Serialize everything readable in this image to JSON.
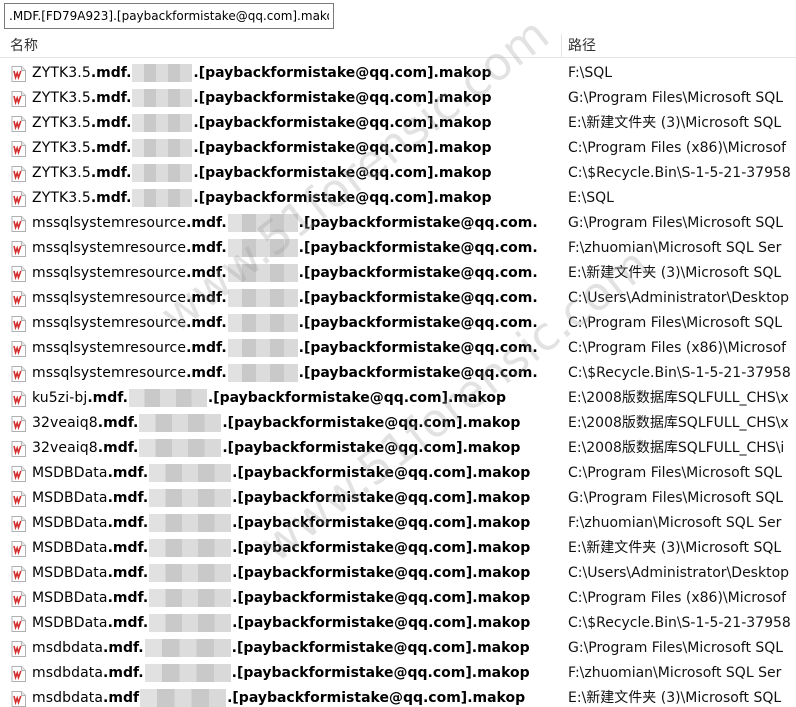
{
  "search": {
    "value": ".MDF.[FD79A923].[paybackformistake@qq.com].makop"
  },
  "columns": {
    "name": "名称",
    "path": "路径"
  },
  "watermark": "www.51forensic.com",
  "rows": [
    {
      "prefix": "ZYTK3.5",
      "ext": ".mdf.",
      "blur": 60,
      "suffix": ".[paybackformistake@qq.com].makop",
      "path": "F:\\SQL"
    },
    {
      "prefix": "ZYTK3.5",
      "ext": ".mdf.",
      "blur": 60,
      "suffix": ".[paybackformistake@qq.com].makop",
      "path": "G:\\Program Files\\Microsoft SQL"
    },
    {
      "prefix": "ZYTK3.5",
      "ext": ".mdf.",
      "blur": 60,
      "suffix": ".[paybackformistake@qq.com].makop",
      "path": "E:\\新建文件夹 (3)\\Microsoft SQL"
    },
    {
      "prefix": "ZYTK3.5",
      "ext": ".mdf.",
      "blur": 60,
      "suffix": ".[paybackformistake@qq.com].makop",
      "path": "C:\\Program Files (x86)\\Microsof"
    },
    {
      "prefix": "ZYTK3.5",
      "ext": ".mdf.",
      "blur": 60,
      "suffix": ".[paybackformistake@qq.com].makop",
      "path": "C:\\$Recycle.Bin\\S-1-5-21-37958"
    },
    {
      "prefix": "ZYTK3.5",
      "ext": ".mdf.",
      "blur": 60,
      "suffix": ".[paybackformistake@qq.com].makop",
      "path": "E:\\SQL"
    },
    {
      "prefix": "mssqlsystemresource",
      "ext": ".mdf.",
      "blur": 70,
      "suffix": ".[paybackformistake@qq.com.",
      "path": "G:\\Program Files\\Microsoft SQL"
    },
    {
      "prefix": "mssqlsystemresource",
      "ext": ".mdf.",
      "blur": 70,
      "suffix": ".[paybackformistake@qq.com.",
      "path": "F:\\zhuomian\\Microsoft SQL Ser"
    },
    {
      "prefix": "mssqlsystemresource",
      "ext": ".mdf.",
      "blur": 70,
      "suffix": ".[paybackformistake@qq.com.",
      "path": "E:\\新建文件夹 (3)\\Microsoft SQL"
    },
    {
      "prefix": "mssqlsystemresource",
      "ext": ".mdf.",
      "blur": 70,
      "suffix": ".[paybackformistake@qq.com.",
      "path": "C:\\Users\\Administrator\\Desktop"
    },
    {
      "prefix": "mssqlsystemresource",
      "ext": ".mdf.",
      "blur": 70,
      "suffix": ".[paybackformistake@qq.com.",
      "path": "C:\\Program Files\\Microsoft SQL"
    },
    {
      "prefix": "mssqlsystemresource",
      "ext": ".mdf.",
      "blur": 70,
      "suffix": ".[paybackformistake@qq.com.",
      "path": "C:\\Program Files (x86)\\Microsof"
    },
    {
      "prefix": "mssqlsystemresource",
      "ext": ".mdf.",
      "blur": 70,
      "suffix": ".[paybackformistake@qq.com.",
      "path": "C:\\$Recycle.Bin\\S-1-5-21-37958"
    },
    {
      "prefix": "ku5zi-bj",
      "ext": ".mdf.",
      "blur": 78,
      "suffix": ".[paybackformistake@qq.com].makop",
      "path": "E:\\2008版数据库SQLFULL_CHS\\x"
    },
    {
      "prefix": "32veaiq8",
      "ext": ".mdf.",
      "blur": 82,
      "suffix": ".[paybackformistake@qq.com].makop",
      "path": "E:\\2008版数据库SQLFULL_CHS\\x"
    },
    {
      "prefix": "32veaiq8",
      "ext": ".mdf.",
      "blur": 82,
      "suffix": ".[paybackformistake@qq.com].makop",
      "path": "E:\\2008版数据库SQLFULL_CHS\\i"
    },
    {
      "prefix": "MSDBData",
      "ext": ".mdf.",
      "blur": 82,
      "suffix": ".[paybackformistake@qq.com].makop",
      "path": "C:\\Program Files\\Microsoft SQL"
    },
    {
      "prefix": "MSDBData",
      "ext": ".mdf.",
      "blur": 82,
      "suffix": ".[paybackformistake@qq.com].makop",
      "path": "G:\\Program Files\\Microsoft SQL"
    },
    {
      "prefix": "MSDBData",
      "ext": ".mdf.",
      "blur": 82,
      "suffix": ".[paybackformistake@qq.com].makop",
      "path": "F:\\zhuomian\\Microsoft SQL Ser"
    },
    {
      "prefix": "MSDBData",
      "ext": ".mdf.",
      "blur": 82,
      "suffix": ".[paybackformistake@qq.com].makop",
      "path": "E:\\新建文件夹 (3)\\Microsoft SQL"
    },
    {
      "prefix": "MSDBData",
      "ext": ".mdf.",
      "blur": 82,
      "suffix": ".[paybackformistake@qq.com].makop",
      "path": "C:\\Users\\Administrator\\Desktop"
    },
    {
      "prefix": "MSDBData",
      "ext": ".mdf.",
      "blur": 82,
      "suffix": ".[paybackformistake@qq.com].makop",
      "path": "C:\\Program Files (x86)\\Microsof"
    },
    {
      "prefix": "MSDBData",
      "ext": ".mdf.",
      "blur": 82,
      "suffix": ".[paybackformistake@qq.com].makop",
      "path": "C:\\$Recycle.Bin\\S-1-5-21-37958"
    },
    {
      "prefix": "msdbdata",
      "ext": ".mdf.",
      "blur": 86,
      "suffix": ".[paybackformistake@qq.com].makop",
      "path": "G:\\Program Files\\Microsoft SQL"
    },
    {
      "prefix": "msdbdata",
      "ext": ".mdf.",
      "blur": 86,
      "suffix": ".[paybackformistake@qq.com].makop",
      "path": "F:\\zhuomian\\Microsoft SQL Ser"
    },
    {
      "prefix": "msdbdata",
      "ext": ".mdf",
      "blur": 86,
      "suffix": ".[paybackformistake@qq.com].makop",
      "path": "E:\\新建文件夹 (3)\\Microsoft SQL"
    }
  ]
}
